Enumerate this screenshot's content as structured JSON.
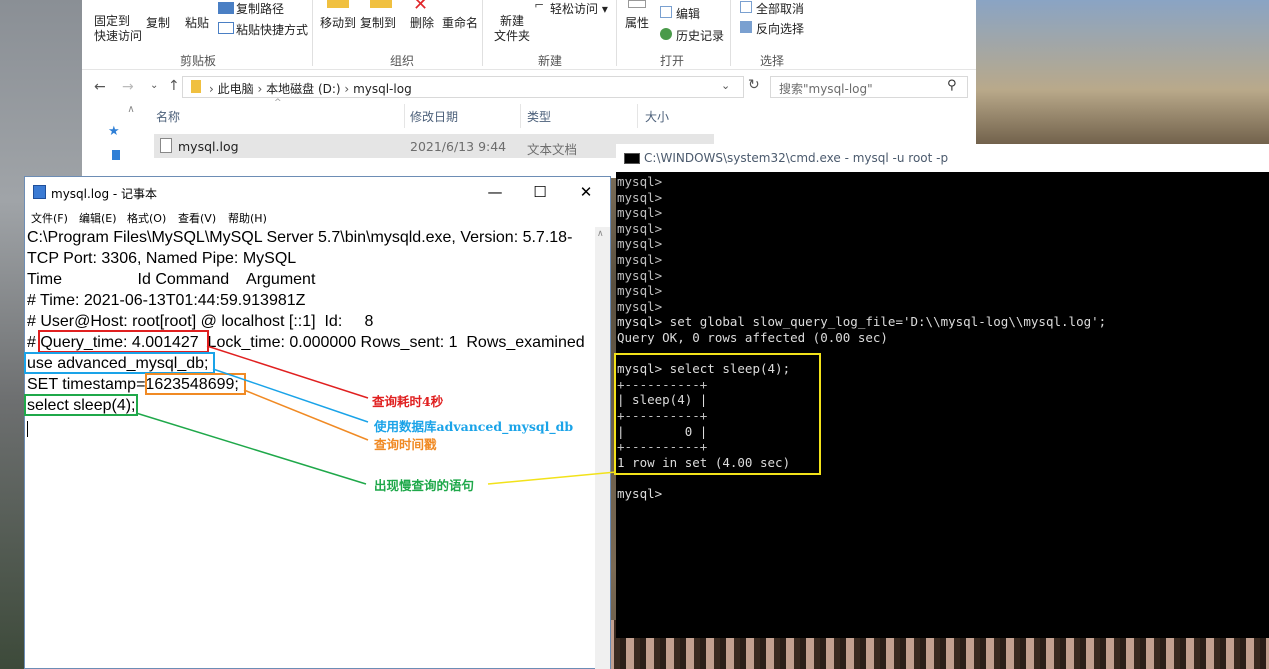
{
  "explorer": {
    "ribbon": {
      "pin_label": "固定到\n快速访问",
      "copy_label": "复制",
      "paste_label": "粘贴",
      "copy_path_label": "复制路径",
      "paste_shortcut_label": "粘贴快捷方式",
      "clipboard_group": "剪贴板",
      "move_to_label": "移动到",
      "copy_to_label": "复制到",
      "delete_label": "删除",
      "rename_label": "重命名",
      "organize_group": "组织",
      "new_folder_label": "新建\n文件夹",
      "easy_access_label": "轻松访问",
      "new_group": "新建",
      "properties_label": "属性",
      "edit_label": "编辑",
      "history_label": "历史记录",
      "open_group": "打开",
      "select_all_label": "全部取消",
      "invert_selection_label": "反向选择",
      "select_group": "选择"
    },
    "breadcrumb": [
      "此电脑",
      "本地磁盘 (D:)",
      "mysql-log"
    ],
    "search_placeholder": "搜索\"mysql-log\"",
    "columns": [
      "名称",
      "修改日期",
      "类型",
      "大小"
    ],
    "files": [
      {
        "name": "mysql.log",
        "modified": "2021/6/13 9:44",
        "type": "文本文档",
        "size": ""
      }
    ]
  },
  "notepad": {
    "title": "mysql.log - 记事本",
    "menu": [
      "文件(F)",
      "编辑(E)",
      "格式(O)",
      "查看(V)",
      "帮助(H)"
    ],
    "lines": [
      "C:\\Program Files\\MySQL\\MySQL Server 5.7\\bin\\mysqld.exe, Version: 5.7.18-",
      "TCP Port: 3306, Named Pipe: MySQL",
      "Time                 Id Command    Argument",
      "# Time: 2021-06-13T01:44:59.913981Z",
      "# User@Host: root[root] @ localhost [::1]  Id:     8",
      "# Query_time: 4.001427  Lock_time: 0.000000 Rows_sent: 1  Rows_examined",
      "use advanced_mysql_db;",
      "SET timestamp=1623548699;",
      "select sleep(4);"
    ]
  },
  "annotations": {
    "query_time": "查询耗时4秒",
    "database": "使用数据库advanced_mysql_db",
    "timestamp": "查询时间戳",
    "statement": "出现慢查询的语句",
    "colors": {
      "red": "#e02020",
      "blue": "#1aa3e8",
      "orange": "#f08a24",
      "green": "#1fa84a",
      "yellow": "#f2e21a"
    }
  },
  "cmd": {
    "title": "C:\\WINDOWS\\system32\\cmd.exe - mysql  -u root -p",
    "lines": [
      "mysql>",
      "mysql>",
      "mysql>",
      "mysql>",
      "mysql>",
      "mysql>",
      "mysql>",
      "mysql>",
      "mysql>",
      "mysql> set global slow_query_log_file='D:\\\\mysql-log\\\\mysql.log';",
      "Query OK, 0 rows affected (0.00 sec)",
      "",
      "mysql> select sleep(4);",
      "+----------+",
      "| sleep(4) |",
      "+----------+",
      "|        0 |",
      "+----------+",
      "1 row in set (4.00 sec)",
      "",
      "mysql>"
    ]
  }
}
